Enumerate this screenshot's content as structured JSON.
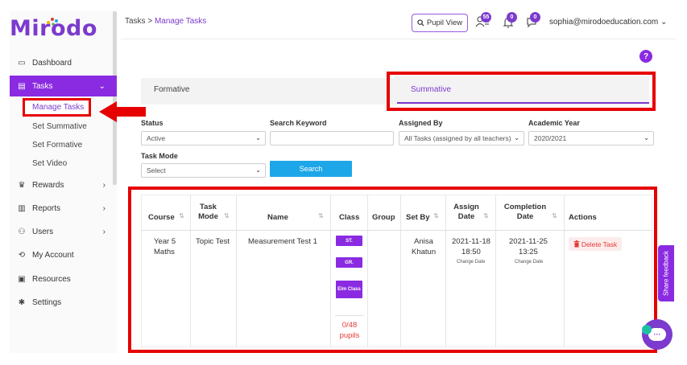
{
  "brand": {
    "name": "Mirodo",
    "accent": "#8a2be2",
    "highlight": "#e60000"
  },
  "sidebar": {
    "items": [
      {
        "label": "Dashboard",
        "icon": "monitor-icon",
        "glyph": "▭"
      },
      {
        "label": "Tasks",
        "icon": "tasks-icon",
        "glyph": "▤",
        "chevron": "⌄"
      },
      {
        "label": "Rewards",
        "icon": "trophy-icon",
        "glyph": "♛",
        "chevron": "›"
      },
      {
        "label": "Reports",
        "icon": "reports-icon",
        "glyph": "▥",
        "chevron": "›"
      },
      {
        "label": "Users",
        "icon": "users-icon",
        "glyph": "⚇",
        "chevron": "›"
      },
      {
        "label": "My Account",
        "icon": "account-icon",
        "glyph": "⟲"
      },
      {
        "label": "Resources",
        "icon": "resources-icon",
        "glyph": "▣"
      },
      {
        "label": "Settings",
        "icon": "gear-icon",
        "glyph": "✱"
      }
    ],
    "sub_items": [
      "Manage Tasks",
      "Set Summative",
      "Set Formative",
      "Set Video"
    ]
  },
  "header": {
    "breadcrumb_root": "Tasks",
    "breadcrumb_sep": ">",
    "breadcrumb_current": "Manage Tasks",
    "pupil_view_label": "Pupil View",
    "badges": [
      "55",
      "0",
      "0"
    ],
    "user_email": "sophia@mirodoeducation.com",
    "user_caret": "⌄",
    "help_glyph": "?"
  },
  "tabs": [
    {
      "label": "Formative"
    },
    {
      "label": "Summative"
    }
  ],
  "filters": {
    "status": {
      "label": "Status",
      "value": "Active"
    },
    "keyword": {
      "label": "Search Keyword",
      "value": ""
    },
    "assigned_by": {
      "label": "Assigned By",
      "value": "All Tasks (assigned by all teachers)"
    },
    "academic_year": {
      "label": "Academic Year",
      "value": "2020/2021"
    },
    "task_mode": {
      "label": "Task Mode",
      "value": "Select"
    },
    "search_label": "Search"
  },
  "table": {
    "headers": {
      "course": "Course",
      "task_mode_1": "Task",
      "task_mode_2": "Mode",
      "name": "Name",
      "class": "Class",
      "group": "Group",
      "set_by": "Set By",
      "assign_1": "Assign",
      "assign_2": "Date",
      "completion_1": "Completion",
      "completion_2": "Date",
      "actions": "Actions"
    },
    "row": {
      "course_1": "Year 5",
      "course_2": "Maths",
      "task_mode": "Topic Test",
      "name": "Measurement Test 1",
      "classes": [
        "ST.",
        "GR.",
        "Elm Class"
      ],
      "pupils_1": "0/48",
      "pupils_2": "pupils",
      "set_by_1": "Anisa",
      "set_by_2": "Khatun",
      "assign_date": "2021-11-18",
      "assign_time": "18:50",
      "completion_date": "2021-11-25",
      "completion_time": "13:25",
      "change_date": "Change Date",
      "delete_label": "Delete Task"
    }
  },
  "feedback_label": "Share feedback",
  "chat_glyph": "···"
}
